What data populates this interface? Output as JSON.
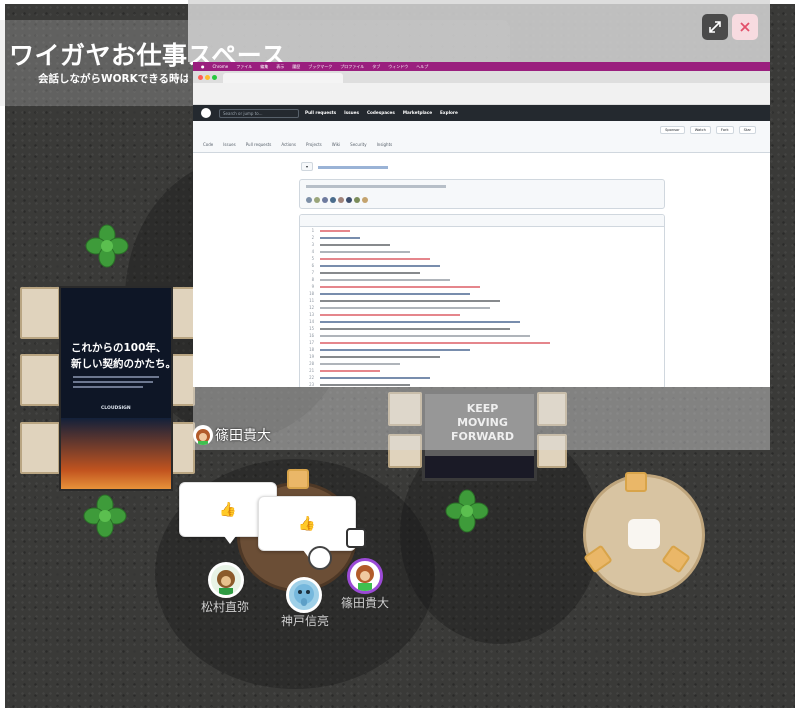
{
  "space": {
    "title": "ワイガヤお仕事スペース",
    "subtitle": "会話しながらWORKできる時はこ"
  },
  "controls": {
    "expand_icon": "expand-arrows-icon",
    "close_icon": "close-x-icon"
  },
  "shared_screen": {
    "mac_menu": [
      "Chrome",
      "ファイル",
      "編集",
      "表示",
      "履歴",
      "ブックマーク",
      "プロファイル",
      "タブ",
      "ウィンドウ",
      "ヘルプ"
    ],
    "github_nav": [
      "Pull requests",
      "Issues",
      "Codespaces",
      "Marketplace",
      "Explore"
    ],
    "search_placeholder": "Search or jump to...",
    "repo_tabs": [
      "Code",
      "Issues",
      "Pull requests",
      "Actions",
      "Projects",
      "Wiki",
      "Security",
      "Insights"
    ],
    "repo_actions": [
      "Sponsor",
      "Watch",
      "Fork",
      "Star"
    ]
  },
  "poster": {
    "line1": "これからの100年、",
    "line2": "新しい契約のかたち。",
    "brand": "CLOUDSIGN"
  },
  "board": {
    "line1": "KEEP",
    "line2": "MOVING",
    "line3": "FORWARD"
  },
  "screen_sharer": {
    "name": "篠田貴大"
  },
  "reactions": {
    "left": "👍",
    "right": "👍"
  },
  "participants": [
    {
      "name": "松村直弥"
    },
    {
      "name": "神戸信亮"
    },
    {
      "name": "篠田貴大"
    }
  ],
  "colors": {
    "menubar": "#9a1f7e",
    "close_button": "#f7dbe0",
    "expand_button": "#4a4a4a",
    "wood": "#eab768"
  }
}
